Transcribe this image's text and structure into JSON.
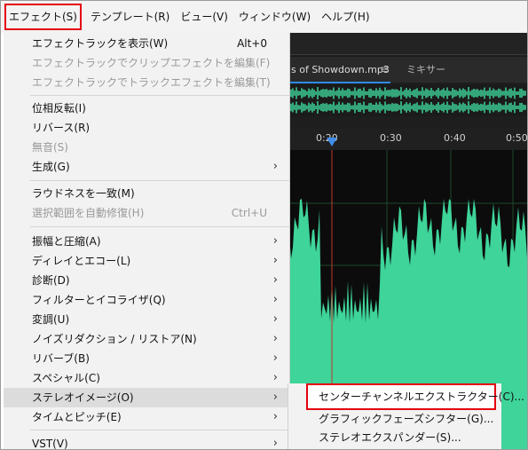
{
  "menubar": {
    "items": [
      {
        "label": "エフェクト(S)",
        "active": true
      },
      {
        "label": "テンプレート(R)"
      },
      {
        "label": "ビュー(V)"
      },
      {
        "label": "ウィンドウ(W)"
      },
      {
        "label": "ヘルプ(H)"
      }
    ]
  },
  "app": {
    "tab_file": "s of Showdown.mp3",
    "tab_mixer": "ミキサー",
    "ruler": [
      "0:20",
      "0:30",
      "0:40",
      "0:50"
    ],
    "accent": "#2d8ceb",
    "waveform_color": "#3ed49a"
  },
  "effects_menu": {
    "items": [
      {
        "label": "エフェクトラックを表示(W)",
        "shortcut": "Alt+0"
      },
      {
        "label": "エフェクトラックでクリップエフェクトを編集(F)",
        "disabled": true
      },
      {
        "label": "エフェクトラックでトラックエフェクトを編集(T)",
        "disabled": true
      },
      {
        "label": "位相反転(I)"
      },
      {
        "label": "リバース(R)"
      },
      {
        "label": "無音(S)",
        "disabled": true
      },
      {
        "label": "生成(G)",
        "submenu": true
      },
      {
        "label": "ラウドネスを一致(M)"
      },
      {
        "label": "選択範囲を自動修復(H)",
        "shortcut": "Ctrl+U",
        "disabled": true
      },
      {
        "label": "振幅と圧縮(A)",
        "submenu": true
      },
      {
        "label": "ディレイとエコー(L)",
        "submenu": true
      },
      {
        "label": "診断(D)",
        "submenu": true
      },
      {
        "label": "フィルターとイコライザ(Q)",
        "submenu": true
      },
      {
        "label": "変調(U)",
        "submenu": true
      },
      {
        "label": "ノイズリダクション / リストア(N)",
        "submenu": true
      },
      {
        "label": "リバーブ(B)",
        "submenu": true
      },
      {
        "label": "スペシャル(C)",
        "submenu": true
      },
      {
        "label": "ステレオイメージ(O)",
        "submenu": true,
        "hover": true
      },
      {
        "label": "タイムとピッチ(E)",
        "submenu": true
      },
      {
        "label": "VST(V)",
        "submenu": true
      }
    ]
  },
  "stereo_submenu": {
    "items": [
      {
        "label": "センターチャンネルエクストラクター(C)...",
        "selected": true
      },
      {
        "label": "グラフィックフェーズシフター(G)..."
      },
      {
        "label": "ステレオエクスパンダー(S)..."
      }
    ]
  },
  "highlight_color": "#e3000f"
}
